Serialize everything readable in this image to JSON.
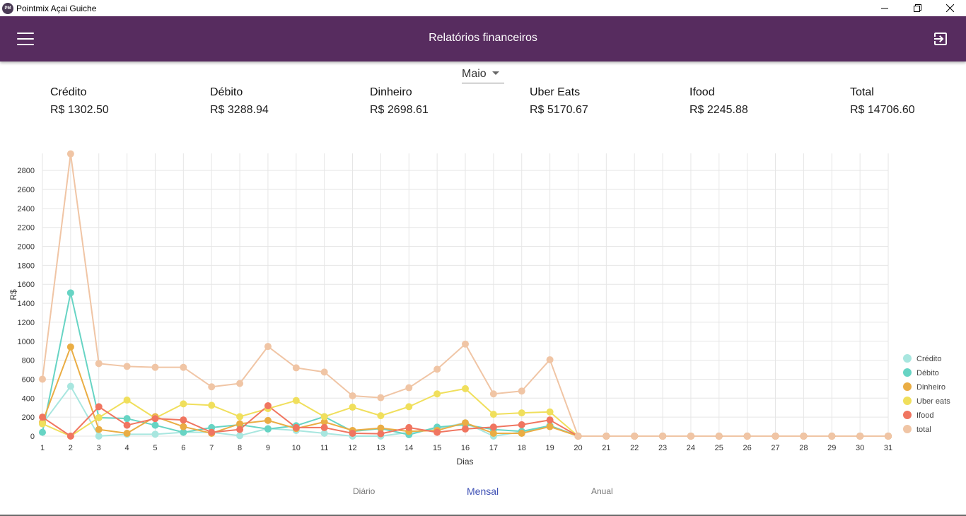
{
  "window": {
    "title": "Pointmix Açai Guiche",
    "icon": "app-logo-icon",
    "controls": [
      "minimize-icon",
      "restore-icon",
      "close-icon"
    ]
  },
  "appbar": {
    "title": "Relatórios financeiros",
    "menu_icon": "hamburger-menu-icon",
    "logout_icon": "logout-icon"
  },
  "month_select": {
    "value": "Maio"
  },
  "stats": [
    {
      "label": "Crédito",
      "value": "R$ 1302.50"
    },
    {
      "label": "Débito",
      "value": "R$ 3288.94"
    },
    {
      "label": "Dinheiro",
      "value": "R$ 2698.61"
    },
    {
      "label": "Uber Eats",
      "value": "R$ 5170.67"
    },
    {
      "label": "Ifood",
      "value": "R$ 2245.88"
    },
    {
      "label": "Total",
      "value": "R$ 14706.60"
    }
  ],
  "tabs": [
    {
      "label": "Diário",
      "active": false
    },
    {
      "label": "Mensal",
      "active": true
    },
    {
      "label": "Anual",
      "active": false
    }
  ],
  "colors": {
    "appbar": "#572c5f",
    "active_tab": "#3f51b5"
  },
  "chart_data": {
    "type": "line",
    "xlabel": "Dias",
    "ylabel": "R$",
    "x": [
      1,
      2,
      3,
      4,
      5,
      6,
      7,
      8,
      9,
      10,
      11,
      12,
      13,
      14,
      15,
      16,
      17,
      18,
      19,
      20,
      21,
      22,
      23,
      24,
      25,
      26,
      27,
      28,
      29,
      30,
      31
    ],
    "ylim": [
      0,
      2980
    ],
    "yticks": [
      0,
      200,
      400,
      600,
      800,
      1000,
      1200,
      1400,
      1600,
      1800,
      2000,
      2200,
      2400,
      2600,
      2800
    ],
    "grid": true,
    "legend_position": "right",
    "series": [
      {
        "name": "Crédito",
        "color": "#a8e6df",
        "values": [
          130,
          525,
          0,
          20,
          20,
          40,
          40,
          5,
          80,
          60,
          30,
          0,
          0,
          40,
          80,
          140,
          0,
          45,
          110,
          0,
          0,
          0,
          0,
          0,
          0,
          0,
          0,
          0,
          0,
          0,
          0
        ]
      },
      {
        "name": "Débito",
        "color": "#67d4c4",
        "values": [
          40,
          1510,
          195,
          185,
          115,
          40,
          90,
          120,
          75,
          110,
          205,
          50,
          80,
          15,
          95,
          120,
          70,
          50,
          110,
          0,
          0,
          0,
          0,
          0,
          0,
          0,
          0,
          0,
          0,
          0,
          0
        ]
      },
      {
        "name": "Dinheiro",
        "color": "#eaad44",
        "values": [
          145,
          940,
          70,
          30,
          205,
          100,
          30,
          130,
          165,
          80,
          150,
          60,
          85,
          50,
          60,
          140,
          30,
          30,
          100,
          0,
          0,
          0,
          0,
          0,
          0,
          0,
          0,
          0,
          0,
          0,
          0
        ]
      },
      {
        "name": "Uber eats",
        "color": "#f0df5c",
        "values": [
          130,
          0,
          195,
          380,
          190,
          340,
          325,
          205,
          290,
          375,
          205,
          305,
          215,
          310,
          445,
          500,
          230,
          245,
          255,
          0,
          0,
          0,
          0,
          0,
          0,
          0,
          0,
          0,
          0,
          0,
          0
        ]
      },
      {
        "name": "Ifood",
        "color": "#f07560",
        "values": [
          200,
          0,
          310,
          115,
          185,
          170,
          40,
          70,
          320,
          90,
          90,
          30,
          25,
          90,
          40,
          75,
          95,
          120,
          170,
          0,
          0,
          0,
          0,
          0,
          0,
          0,
          0,
          0,
          0,
          0,
          0
        ]
      },
      {
        "name": "total",
        "color": "#f0c5a5",
        "values": [
          600,
          2975,
          765,
          735,
          725,
          725,
          520,
          555,
          945,
          720,
          675,
          425,
          405,
          510,
          705,
          970,
          445,
          475,
          805,
          0,
          0,
          0,
          0,
          0,
          0,
          0,
          0,
          0,
          0,
          0,
          0
        ]
      }
    ]
  }
}
